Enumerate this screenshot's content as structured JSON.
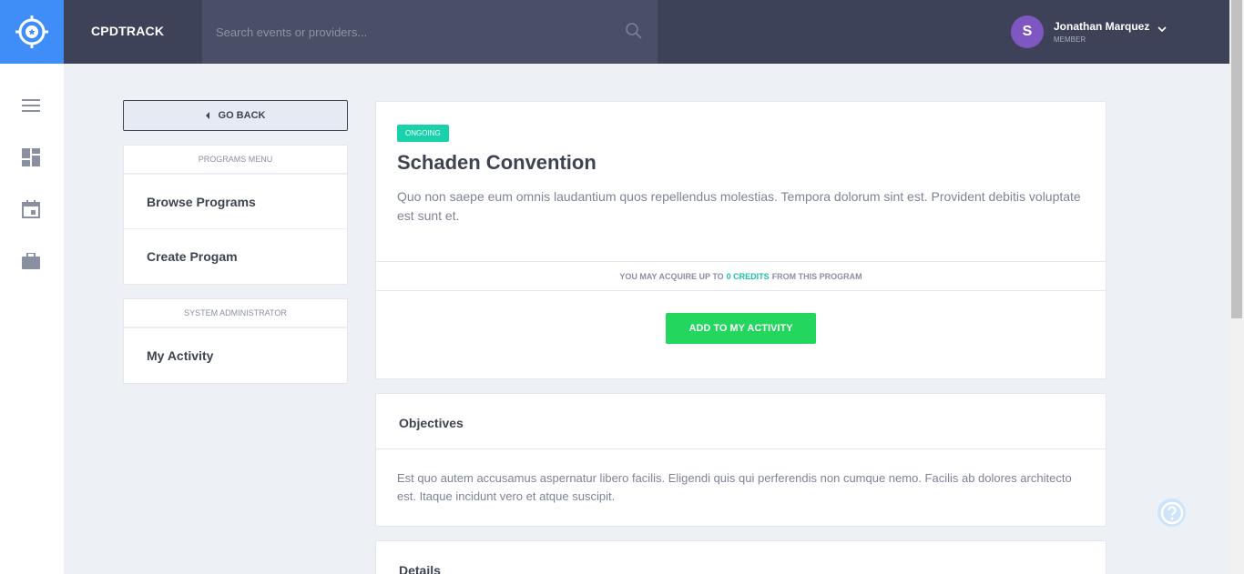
{
  "app": {
    "brand": "CPDTRACK"
  },
  "search": {
    "placeholder": "Search events or providers..."
  },
  "user": {
    "initial": "S",
    "name": "Jonathan Marquez",
    "role": "MEMBER"
  },
  "sidebar": {
    "icons": [
      "menu-icon",
      "dashboard-icon",
      "calendar-icon",
      "briefcase-icon"
    ]
  },
  "nav": {
    "go_back": "GO BACK",
    "programs_menu": {
      "header": "PROGRAMS MENU",
      "items": [
        {
          "label": "Browse Programs"
        },
        {
          "label": "Create Progam"
        }
      ]
    },
    "admin_menu": {
      "header": "SYSTEM ADMINISTRATOR",
      "items": [
        {
          "label": "My Activity"
        }
      ]
    }
  },
  "program": {
    "status": "ONGOING",
    "title": "Schaden Convention",
    "description": "Quo non saepe eum omnis laudantium quos repellendus molestias. Tempora dolorum sint est. Provident debitis voluptate est sunt et.",
    "credits_prefix": "YOU MAY ACQUIRE UP TO",
    "credits_value": "0 CREDITS",
    "credits_suffix": "FROM THIS PROGRAM",
    "add_button": "ADD TO MY ACTIVITY"
  },
  "objectives": {
    "title": "Objectives",
    "body": "Est quo autem accusamus aspernatur libero facilis. Eligendi quis qui perferendis non cumque nemo. Facilis ab dolores architecto est. Itaque incidunt vero et atque suscipit."
  },
  "details": {
    "title": "Details"
  },
  "colors": {
    "topbar": "#3e4258",
    "logo_bg": "#3f8ef7",
    "badge": "#19d1ab",
    "add_button": "#22d65e",
    "avatar": "#7e57c2"
  }
}
